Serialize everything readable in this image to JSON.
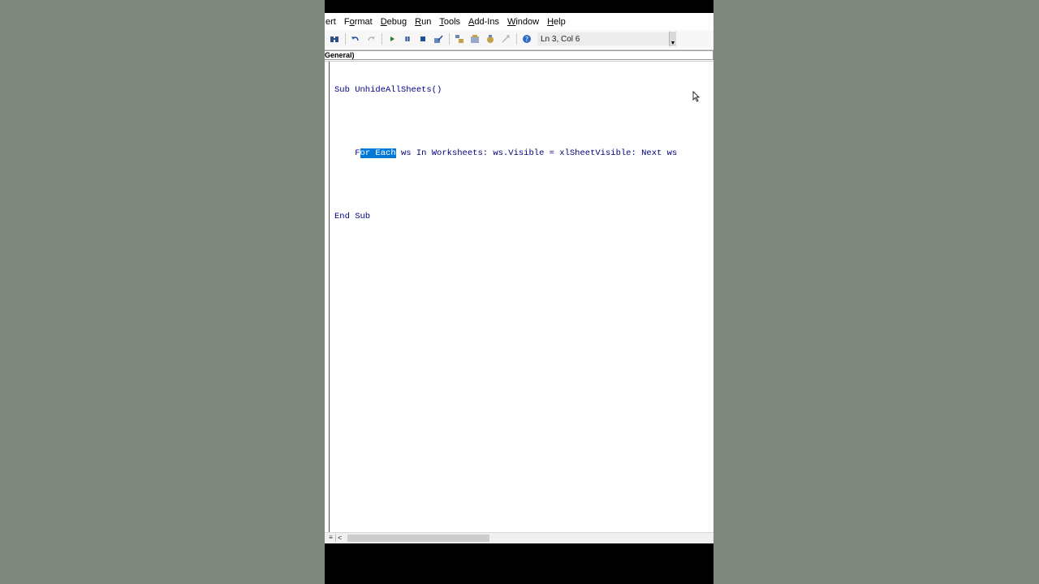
{
  "menu": [
    {
      "label": "ert",
      "hotkey": ""
    },
    {
      "label": "Format",
      "hotkey": "o"
    },
    {
      "label": "Debug",
      "hotkey": "D"
    },
    {
      "label": "Run",
      "hotkey": "R"
    },
    {
      "label": "Tools",
      "hotkey": "T"
    },
    {
      "label": "Add-Ins",
      "hotkey": "A"
    },
    {
      "label": "Window",
      "hotkey": "W"
    },
    {
      "label": "Help",
      "hotkey": "H"
    }
  ],
  "toolbar": {
    "position_text": "Ln 3, Col 6",
    "icons": [
      "find-icon",
      "undo-icon",
      "redo-icon",
      "run-icon",
      "break-icon",
      "reset-icon",
      "design-mode-icon",
      "project-explorer-icon",
      "properties-icon",
      "object-browser-icon",
      "toolbox-icon",
      "help-icon"
    ]
  },
  "object_box": {
    "value": "General)"
  },
  "code": {
    "line1": "Sub UnhideAllSheets()",
    "line2_indent": "    ",
    "line2_pre": "F",
    "line2_sel": "or Each",
    "line2_post": " ws In Worksheets: ws.Visible = xlSheetVisible: Next ws",
    "line3": "End Sub"
  },
  "colors": {
    "keyword": "#00007f",
    "selection": "#0078d7",
    "page_background": "#7f867d"
  }
}
